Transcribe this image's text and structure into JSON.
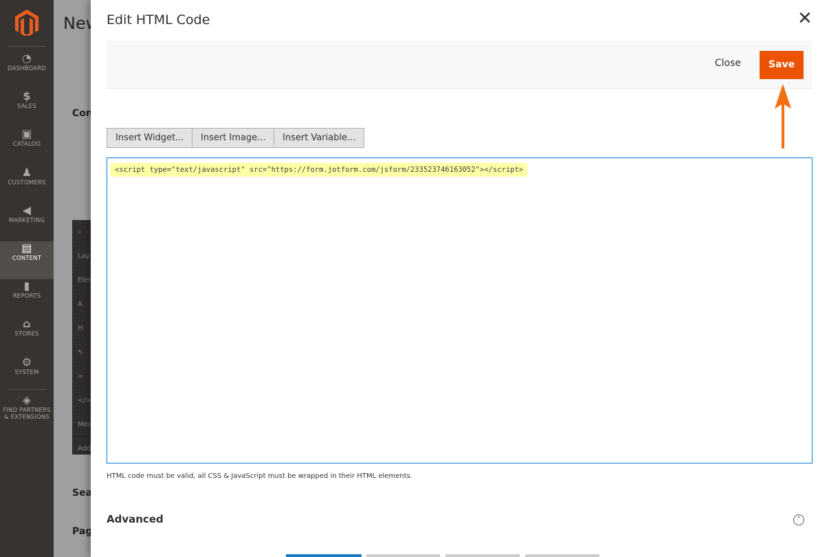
{
  "sidebar": {
    "items": [
      {
        "label": "DASHBOARD",
        "icon": "dashboard-icon",
        "glyph": "◔"
      },
      {
        "label": "SALES",
        "icon": "dollar-icon",
        "glyph": "$"
      },
      {
        "label": "CATALOG",
        "icon": "box-icon",
        "glyph": "▣"
      },
      {
        "label": "CUSTOMERS",
        "icon": "person-icon",
        "glyph": "♟"
      },
      {
        "label": "MARKETING",
        "icon": "megaphone-icon",
        "glyph": "◀"
      },
      {
        "label": "CONTENT",
        "icon": "layout-icon",
        "glyph": "▤"
      },
      {
        "label": "REPORTS",
        "icon": "bar-chart-icon",
        "glyph": "▮"
      },
      {
        "label": "STORES",
        "icon": "store-icon",
        "glyph": "⌂"
      },
      {
        "label": "SYSTEM",
        "icon": "gear-icon",
        "glyph": "⚙"
      },
      {
        "label": "FIND PARTNERS & EXTENSIONS",
        "icon": "blocks-icon",
        "glyph": "◈"
      }
    ]
  },
  "background": {
    "title": "New",
    "section": "Con",
    "panel_rows": [
      "Lay",
      "Elem",
      "A",
      "H",
      "↖",
      "=",
      "</>",
      "Med",
      "Add"
    ],
    "seo": "Sea",
    "page": "Pag"
  },
  "modal": {
    "title": "Edit HTML Code",
    "close_label": "Close",
    "save_label": "Save",
    "insert_buttons": [
      "Insert Widget...",
      "Insert Image...",
      "Insert Variable..."
    ],
    "code": "<script type=\"text/javascript\" src=\"https://form.jotform.com/jsform/233523746163052\"></script>",
    "note": "HTML code must be valid, all CSS & JavaScript must be wrapped in their HTML elements.",
    "advanced": "Advanced"
  },
  "colors": {
    "accent": "#eb5202",
    "arrow": "#f26e12",
    "sidebar": "#373330"
  }
}
